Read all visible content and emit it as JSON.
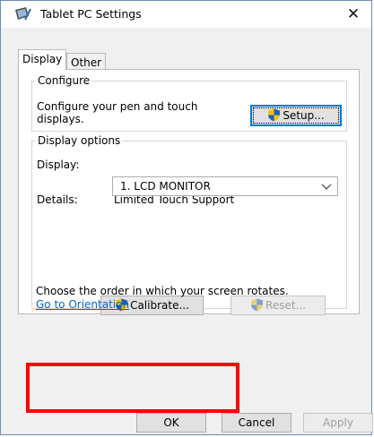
{
  "window": {
    "title": "Tablet PC Settings",
    "close_glyph": "✕"
  },
  "tabs": [
    {
      "label": "Display",
      "active": true
    },
    {
      "label": "Other",
      "active": false
    }
  ],
  "configure": {
    "group_label": "Configure",
    "description": "Configure your pen and touch displays.",
    "setup_button": "Setup..."
  },
  "display_options": {
    "group_label": "Display options",
    "display_label": "Display:",
    "display_value": "1. LCD MONITOR",
    "details_label": "Details:",
    "details_value": "Limited Touch Support",
    "calibrate_button": "Calibrate...",
    "reset_button": "Reset..."
  },
  "orientation": {
    "text": "Choose the order in which your screen rotates.",
    "link": "Go to Orientation"
  },
  "footer": {
    "ok": "OK",
    "cancel": "Cancel",
    "apply": "Apply"
  },
  "colors": {
    "accent": "#0078d7",
    "link": "#0066cc",
    "highlight_box": "#ff0000"
  }
}
